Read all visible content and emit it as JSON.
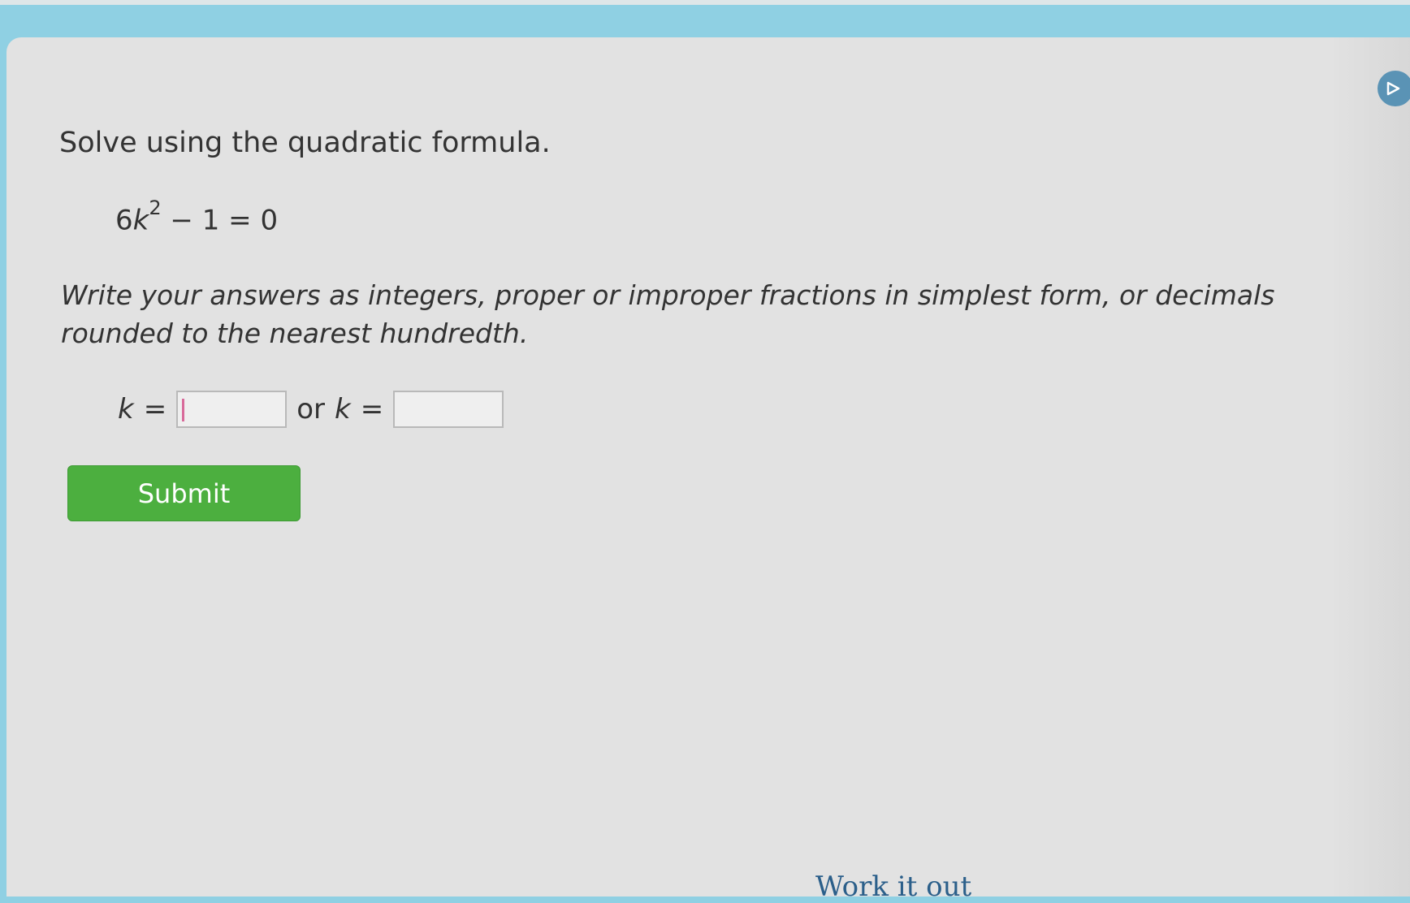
{
  "question": {
    "prompt": "Solve using the quadratic formula.",
    "equation": {
      "coefficient": "6",
      "variable": "k",
      "exponent": "2",
      "rest": " − 1 = 0"
    },
    "instructions": "Write your answers as integers, proper or improper fractions in simplest form, or decimals rounded to the nearest hundredth."
  },
  "answer": {
    "variable": "k",
    "equals": "=",
    "connector": "or",
    "first_value": "",
    "second_value": ""
  },
  "buttons": {
    "submit_label": "Submit"
  },
  "footer": {
    "work_it_out_label": "Work it out"
  },
  "icons": {
    "next": "play-icon"
  },
  "colors": {
    "submit_green": "#4caf3f",
    "nav_blue": "#5a93b5",
    "background_blue": "#8fd0e3",
    "link_blue": "#2b5f8a"
  }
}
